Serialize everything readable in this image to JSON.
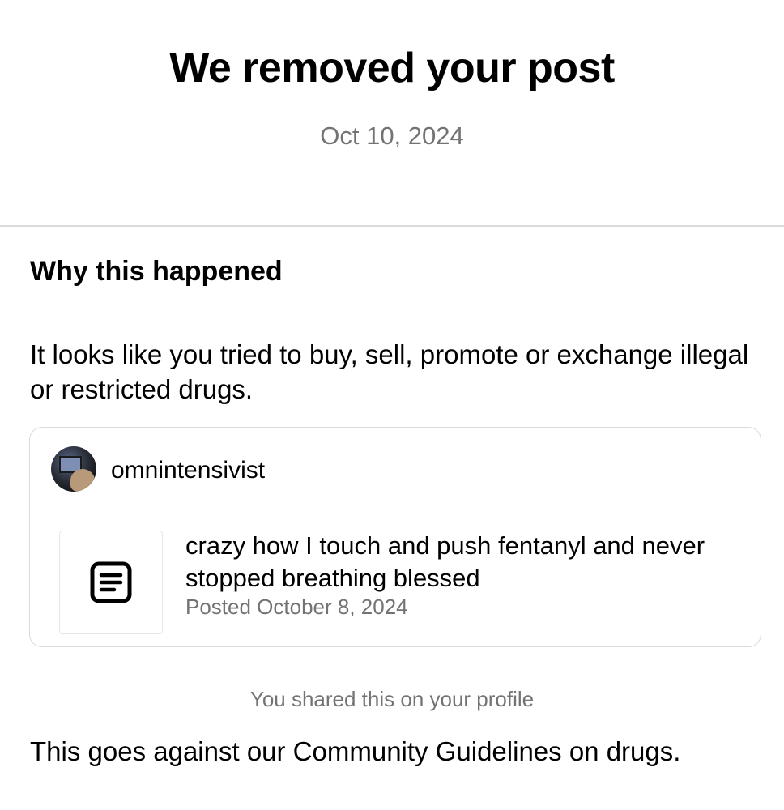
{
  "header": {
    "title": "We removed your post",
    "date": "Oct 10, 2024"
  },
  "reason_section": {
    "heading": "Why this happened",
    "text": "It looks like you tried to buy, sell, promote or exchange illegal or restricted drugs."
  },
  "post_card": {
    "username": "omnintensivist",
    "thumbnail_icon": "text-post-icon",
    "post_text": "crazy how I touch and push fentanyl and never stopped breathing blessed",
    "posted_date": "Posted October 8, 2024"
  },
  "shared_note": "You shared this on your profile",
  "guideline_text": "This goes against our Community Guidelines on drugs.",
  "colors": {
    "secondary_text": "#737373",
    "divider": "#dbdbdb"
  }
}
